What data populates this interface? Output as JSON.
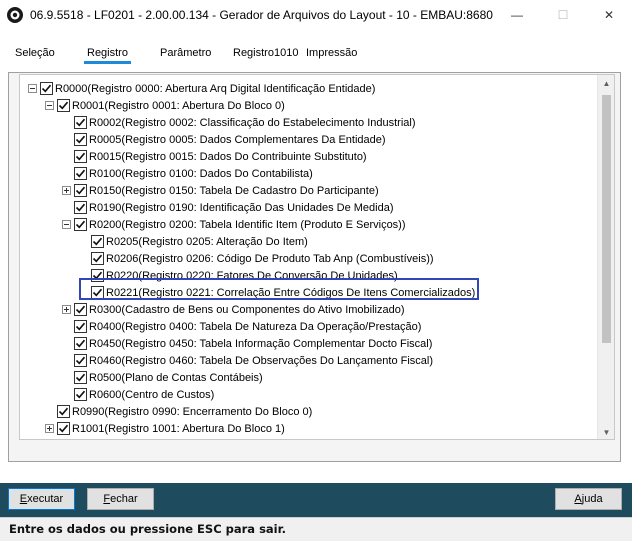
{
  "window": {
    "title": "06.9.5518 - LF0201 - 2.00.00.134 - Gerador de Arquivos do Layout - 10 - EMBAU:8680",
    "minimize_glyph": "—",
    "maximize_glyph": "☐",
    "close_glyph": "✕"
  },
  "tabs": [
    {
      "label": "Seleção"
    },
    {
      "label": "Registro"
    },
    {
      "label": "Parâmetro"
    },
    {
      "label": "Registro1010"
    },
    {
      "label": "Impressão"
    }
  ],
  "tree": {
    "items": [
      {
        "label": "R0000(Registro 0000: Abertura Arq Digital Identificação Entidade)",
        "level": 0,
        "expander": "minus",
        "checked": true
      },
      {
        "label": "R0001(Registro 0001: Abertura Do Bloco 0)",
        "level": 1,
        "expander": "minus",
        "checked": true
      },
      {
        "label": "R0002(Registro 0002: Classificação do Estabelecimento Industrial)",
        "level": 2,
        "expander": "none",
        "checked": true
      },
      {
        "label": "R0005(Registro 0005: Dados Complementares Da Entidade)",
        "level": 2,
        "expander": "none",
        "checked": true
      },
      {
        "label": "R0015(Registro 0015: Dados Do Contribuinte Substituto)",
        "level": 2,
        "expander": "none",
        "checked": true
      },
      {
        "label": "R0100(Registro 0100: Dados Do Contabilista)",
        "level": 2,
        "expander": "none",
        "checked": true
      },
      {
        "label": "R0150(Registro 0150: Tabela De Cadastro Do Participante)",
        "level": 2,
        "expander": "plus",
        "checked": true
      },
      {
        "label": "R0190(Registro 0190: Identificação Das Unidades De Medida)",
        "level": 2,
        "expander": "none",
        "checked": true
      },
      {
        "label": "R0200(Registro 0200: Tabela Identific Item (Produto E Serviços))",
        "level": 2,
        "expander": "minus",
        "checked": true
      },
      {
        "label": "R0205(Registro 0205: Alteração Do Item)",
        "level": 3,
        "expander": "none",
        "checked": true
      },
      {
        "label": "R0206(Registro 0206: Código De Produto Tab Anp (Combustíveis))",
        "level": 3,
        "expander": "none",
        "checked": true
      },
      {
        "label": "R0220(Registro 0220: Fatores De Conversão De Unidades)",
        "level": 3,
        "expander": "none",
        "checked": true
      },
      {
        "label": "R0221(Registro 0221: Correlação Entre Códigos De Itens Comercializados)",
        "level": 3,
        "expander": "none",
        "checked": true
      },
      {
        "label": "R0300(Cadastro de Bens ou Componentes do Ativo Imobilizado)",
        "level": 2,
        "expander": "plus",
        "checked": true
      },
      {
        "label": "R0400(Registro 0400: Tabela De Natureza Da Operação/Prestação)",
        "level": 2,
        "expander": "none",
        "checked": true
      },
      {
        "label": "R0450(Registro 0450: Tabela Informação Complementar Docto Fiscal)",
        "level": 2,
        "expander": "none",
        "checked": true
      },
      {
        "label": "R0460(Registro 0460: Tabela De Observações Do Lançamento Fiscal)",
        "level": 2,
        "expander": "none",
        "checked": true
      },
      {
        "label": "R0500(Plano de Contas Contábeis)",
        "level": 2,
        "expander": "none",
        "checked": true
      },
      {
        "label": "R0600(Centro de Custos)",
        "level": 2,
        "expander": "none",
        "checked": true
      },
      {
        "label": "R0990(Registro 0990: Encerramento Do Bloco 0)",
        "level": 1,
        "expander": "none",
        "checked": true
      },
      {
        "label": "R1001(Registro 1001: Abertura Do Bloco 1)",
        "level": 1,
        "expander": "plus",
        "checked": true
      }
    ]
  },
  "scrollbar": {
    "up_glyph": "▲",
    "down_glyph": "▼"
  },
  "buttons": {
    "execute": {
      "mnemonic": "E",
      "rest": "xecutar"
    },
    "close": {
      "mnemonic": "F",
      "rest": "echar"
    },
    "help": {
      "mnemonic": "A",
      "rest": "juda"
    }
  },
  "status_text": "Entre os dados ou pressione ESC para sair.",
  "colors": {
    "accent": "#1c8ad8",
    "footer": "#1f4b5e",
    "highlight_border": "#3346b8"
  }
}
